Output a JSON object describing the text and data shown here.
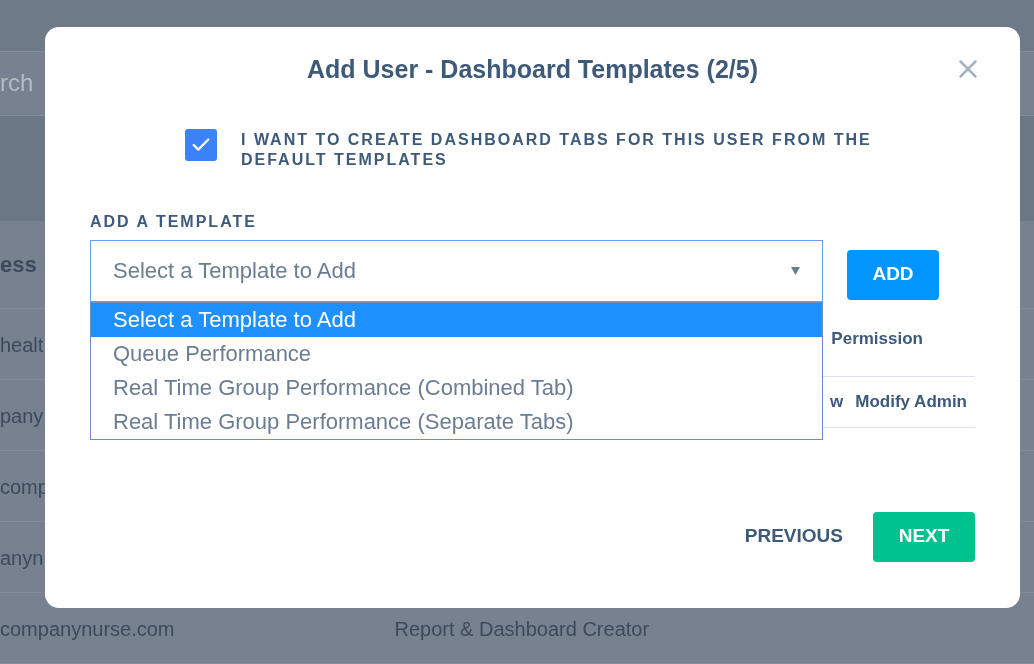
{
  "background": {
    "search_fragment": "rch",
    "column_fragment": "ess",
    "rows": [
      [
        "healt"
      ],
      [
        "pany"
      ],
      [
        "comp"
      ],
      [
        "anyn"
      ],
      [
        "companynurse.com",
        "Report & Dashboard Creator"
      ]
    ]
  },
  "modal": {
    "title": "Add User - Dashboard Templates (2/5)",
    "checkbox": {
      "label": "I WANT TO CREATE DASHBOARD TABS FOR THIS USER FROM THE DEFAULT TEMPLATES",
      "checked": true
    },
    "template_field": {
      "label": "ADD A TEMPLATE",
      "value": "Select a Template to Add",
      "expanded": true,
      "options": [
        {
          "label": "Select a Template to Add",
          "selected": true
        },
        {
          "label": "Queue Performance",
          "selected": false
        },
        {
          "label": "Real Time Group Performance (Combined Tab)",
          "selected": false
        },
        {
          "label": "Real Time Group Performance (Separate Tabs)",
          "selected": false
        }
      ]
    },
    "add_button": "ADD",
    "table": {
      "header": "Permission",
      "row": [
        "w",
        "Modify Admin"
      ]
    },
    "footer": {
      "previous": "PREVIOUS",
      "next": "NEXT"
    }
  }
}
